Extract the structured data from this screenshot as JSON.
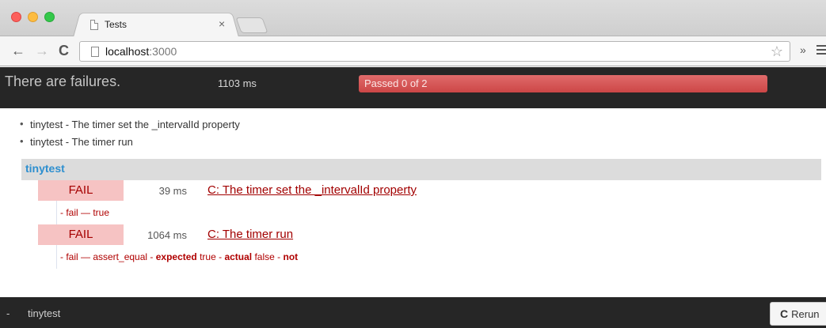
{
  "browser": {
    "tab_title": "Tests",
    "tab_close": "×",
    "url_host": "localhost",
    "url_port": ":3000",
    "overflow": "»"
  },
  "header": {
    "status": "There are failures.",
    "duration": "1103 ms",
    "progress_label": "Passed 0 of 2",
    "progress_fraction": 0
  },
  "summary": {
    "items": [
      "tinytest - The timer set the _intervalId property",
      "tinytest - The timer run"
    ]
  },
  "group": {
    "name": "tinytest",
    "tests": [
      {
        "status": "FAIL",
        "time": "39 ms",
        "name": "C: The timer set the _intervalId property",
        "fail_prefix": "- fail — true"
      },
      {
        "status": "FAIL",
        "time": "1064 ms",
        "name": "C: The timer run",
        "fail_prefix": "- fail — assert_equal - ",
        "fail_expected_label": "expected",
        "fail_expected_value": " true - ",
        "fail_actual_label": "actual",
        "fail_actual_value": " false - ",
        "fail_not": "not"
      }
    ]
  },
  "footer": {
    "dash": "-",
    "label": "tinytest",
    "rerun_label": "Rerun"
  },
  "colors": {
    "header_bg": "#262626",
    "fail": "#a20000",
    "progress": "#d85252",
    "group_title": "#2d8fcf"
  }
}
